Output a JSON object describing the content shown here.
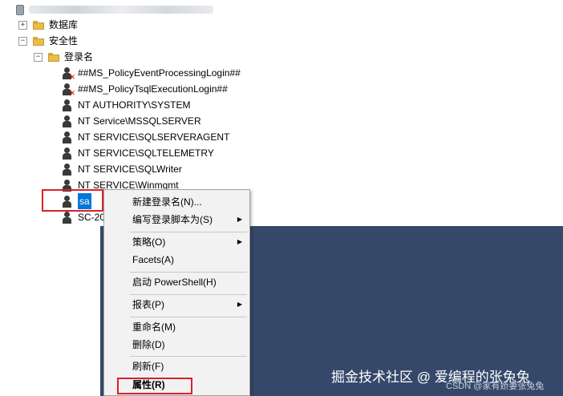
{
  "tree": {
    "root_label": "",
    "databases_label": "数据库",
    "security_label": "安全性",
    "logins_label": "登录名",
    "logins": [
      {
        "label": "##MS_PolicyEventProcessingLogin##",
        "disabled": true
      },
      {
        "label": "##MS_PolicyTsqlExecutionLogin##",
        "disabled": true
      },
      {
        "label": "NT AUTHORITY\\SYSTEM",
        "disabled": false
      },
      {
        "label": "NT Service\\MSSQLSERVER",
        "disabled": false
      },
      {
        "label": "NT SERVICE\\SQLSERVERAGENT",
        "disabled": false
      },
      {
        "label": "NT SERVICE\\SQLTELEMETRY",
        "disabled": false
      },
      {
        "label": "NT SERVICE\\SQLWriter",
        "disabled": false
      },
      {
        "label": "NT SERVICE\\Winmgmt",
        "disabled": false
      },
      {
        "label": "sa",
        "disabled": false,
        "selected": true
      },
      {
        "label": "SC-20",
        "disabled": false
      }
    ]
  },
  "context_menu": {
    "items": [
      {
        "label": "新建登录名(N)...",
        "submenu": false
      },
      {
        "label": "编写登录脚本为(S)",
        "submenu": true
      },
      {
        "label": "策略(O)",
        "submenu": true
      },
      {
        "label": "Facets(A)",
        "submenu": false
      },
      {
        "label": "启动 PowerShell(H)",
        "submenu": false
      },
      {
        "label": "报表(P)",
        "submenu": true
      },
      {
        "label": "重命名(M)",
        "submenu": false
      },
      {
        "label": "删除(D)",
        "submenu": false
      },
      {
        "label": "刷新(F)",
        "submenu": false
      },
      {
        "label": "属性(R)",
        "submenu": false,
        "bold": true
      }
    ]
  },
  "watermark": {
    "main": "掘金技术社区 @ 爱编程的张兔兔",
    "sub": "CSDN @家有娇妻张兔兔"
  },
  "colors": {
    "selection": "#0078d7",
    "highlight_box": "#d9212b",
    "background_dark": "#35486a"
  }
}
